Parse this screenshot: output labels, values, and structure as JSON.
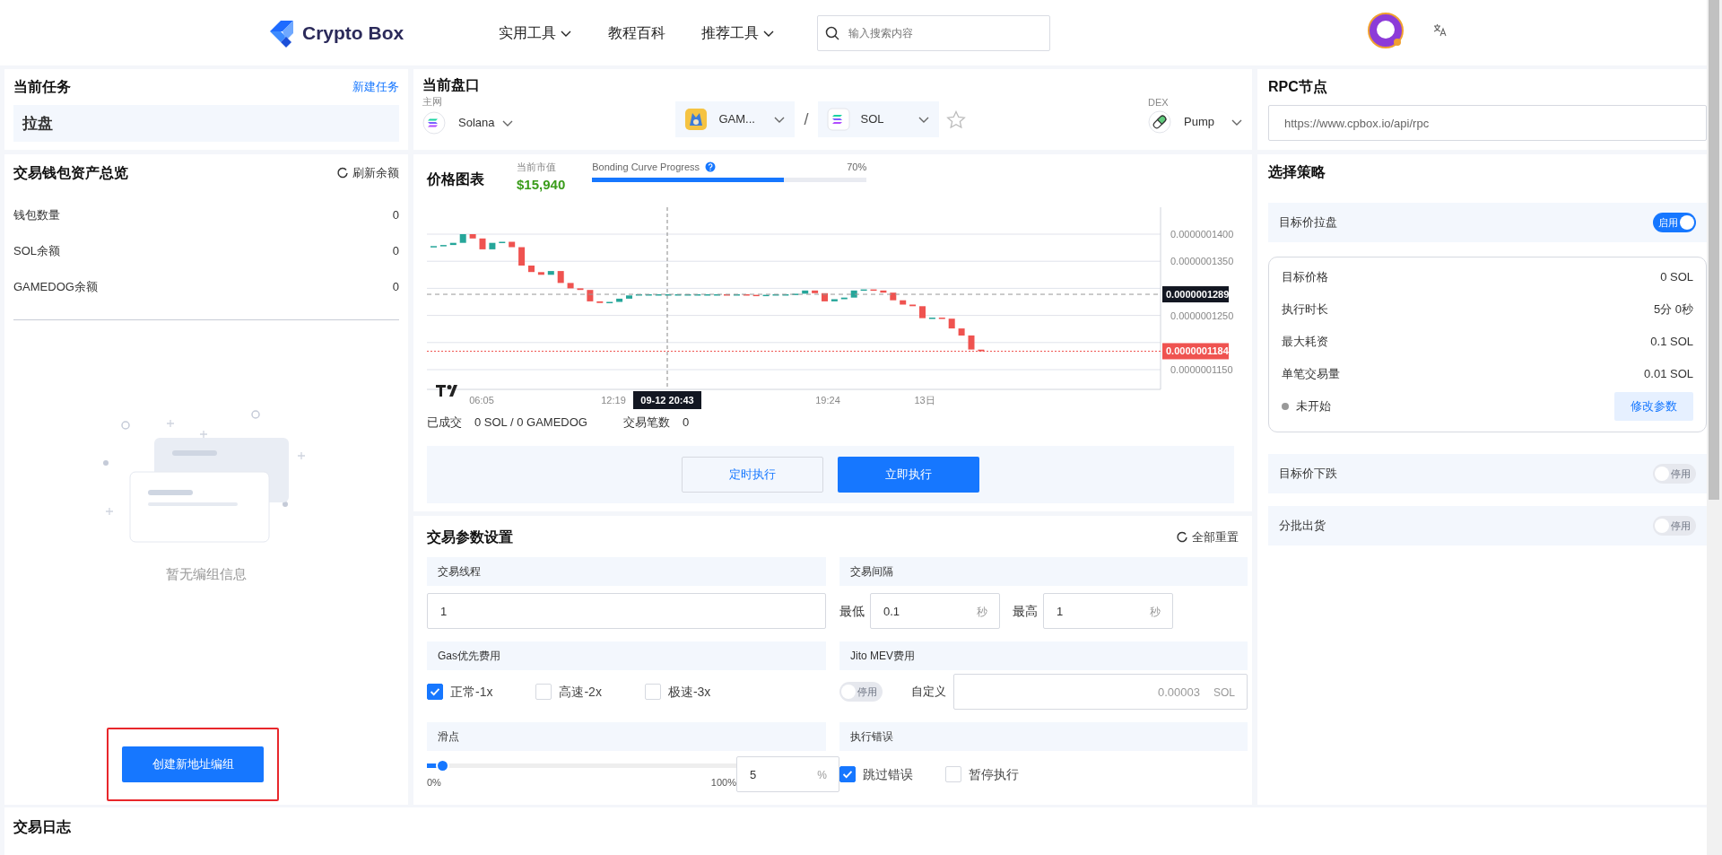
{
  "header": {
    "logo_text": "Crypto Box",
    "nav": [
      {
        "label": "实用工具",
        "dropdown": true
      },
      {
        "label": "教程百科",
        "dropdown": false
      },
      {
        "label": "推荐工具",
        "dropdown": true
      }
    ],
    "search": {
      "placeholder": "输入搜索内容"
    }
  },
  "current_task": {
    "title": "当前任务",
    "link": "新建任务",
    "task": "拉盘"
  },
  "wallet_overview": {
    "title": "交易钱包资产总览",
    "refresh": "刷新余额",
    "rows": [
      {
        "label": "钱包数量",
        "value": "0"
      },
      {
        "label": "SOL余额",
        "value": "0"
      },
      {
        "label": "GAMEDOG余额",
        "value": "0"
      }
    ],
    "empty_text": "暂无编组信息",
    "button": "创建新地址编组",
    "highlighted": true
  },
  "market": {
    "title": "当前盘口",
    "network_label": "主网",
    "network": "Solana",
    "base_token": "GAM...",
    "separator": "/",
    "quote_token": "SOL",
    "favorite": false,
    "dex_label": "DEX",
    "dex": "Pump"
  },
  "price_chart": {
    "title": "价格图表",
    "market_cap_label": "当前市值",
    "market_cap": "$15,940",
    "progress": {
      "label": "Bonding Curve Progress",
      "text": "70%",
      "level": 0.7
    },
    "y_ticks": [
      "0.0000001400",
      "0.0000001350",
      "0.0000001250",
      "0.0000001150"
    ],
    "x_labels": [
      "06:05",
      "12:19",
      "19:24",
      "13日"
    ],
    "crosshair_label": "09-12 20:43",
    "last_price": "0.0000001289",
    "current_price": "0.0000001184",
    "filled_label": "已成交",
    "filled_value": "0 SOL / 0 GAMEDOG",
    "trades_label": "交易笔数",
    "trades_value": "0",
    "buttons": [
      {
        "label": "定时执行",
        "kind": "outline"
      },
      {
        "label": "立即执行",
        "kind": "primary"
      }
    ]
  },
  "trade_params": {
    "title": "交易参数设置",
    "reset": "全部重置",
    "threads": {
      "label": "交易线程",
      "value": "1"
    },
    "interval": {
      "label": "交易间隔",
      "min_label": "最低",
      "min_value": "0.1",
      "min_unit": "秒",
      "max_label": "最高",
      "max_value": "1",
      "max_unit": "秒"
    },
    "gas": {
      "label": "Gas优先费用",
      "options": [
        {
          "label": "正常-1x",
          "checked": true
        },
        {
          "label": "高速-2x",
          "checked": false
        },
        {
          "label": "极速-3x",
          "checked": false
        }
      ]
    },
    "jito": {
      "label": "Jito MEV费用",
      "on": false,
      "toggle_text": "停用",
      "custom_label": "自定义",
      "placeholder": "0.00003",
      "unit": "SOL"
    },
    "slippage": {
      "label": "滑点",
      "level": 0.05,
      "min_label": "0%",
      "max_label": "100%",
      "value": "5",
      "unit": "%"
    },
    "on_error": {
      "label": "执行错误",
      "options": [
        {
          "label": "跳过错误",
          "checked": true
        },
        {
          "label": "暂停执行",
          "checked": false
        }
      ]
    }
  },
  "rpc": {
    "title": "RPC节点",
    "value": "https://www.cpbox.io/api/rpc"
  },
  "strategy": {
    "title": "选择策略",
    "items": [
      {
        "name": "目标价拉盘",
        "on": true,
        "toggle_text": "启用",
        "details": {
          "rows": [
            {
              "label": "目标价格",
              "value": "0 SOL"
            },
            {
              "label": "执行时长",
              "value": "5分 0秒"
            },
            {
              "label": "最大耗资",
              "value": "0.1 SOL"
            },
            {
              "label": "单笔交易量",
              "value": "0.01 SOL"
            }
          ],
          "status": "未开始",
          "button": "修改参数"
        }
      },
      {
        "name": "目标价下跌",
        "on": false,
        "toggle_text": "停用"
      },
      {
        "name": "分批出货",
        "on": false,
        "toggle_text": "停用"
      }
    ]
  },
  "trade_log": {
    "title": "交易日志"
  }
}
